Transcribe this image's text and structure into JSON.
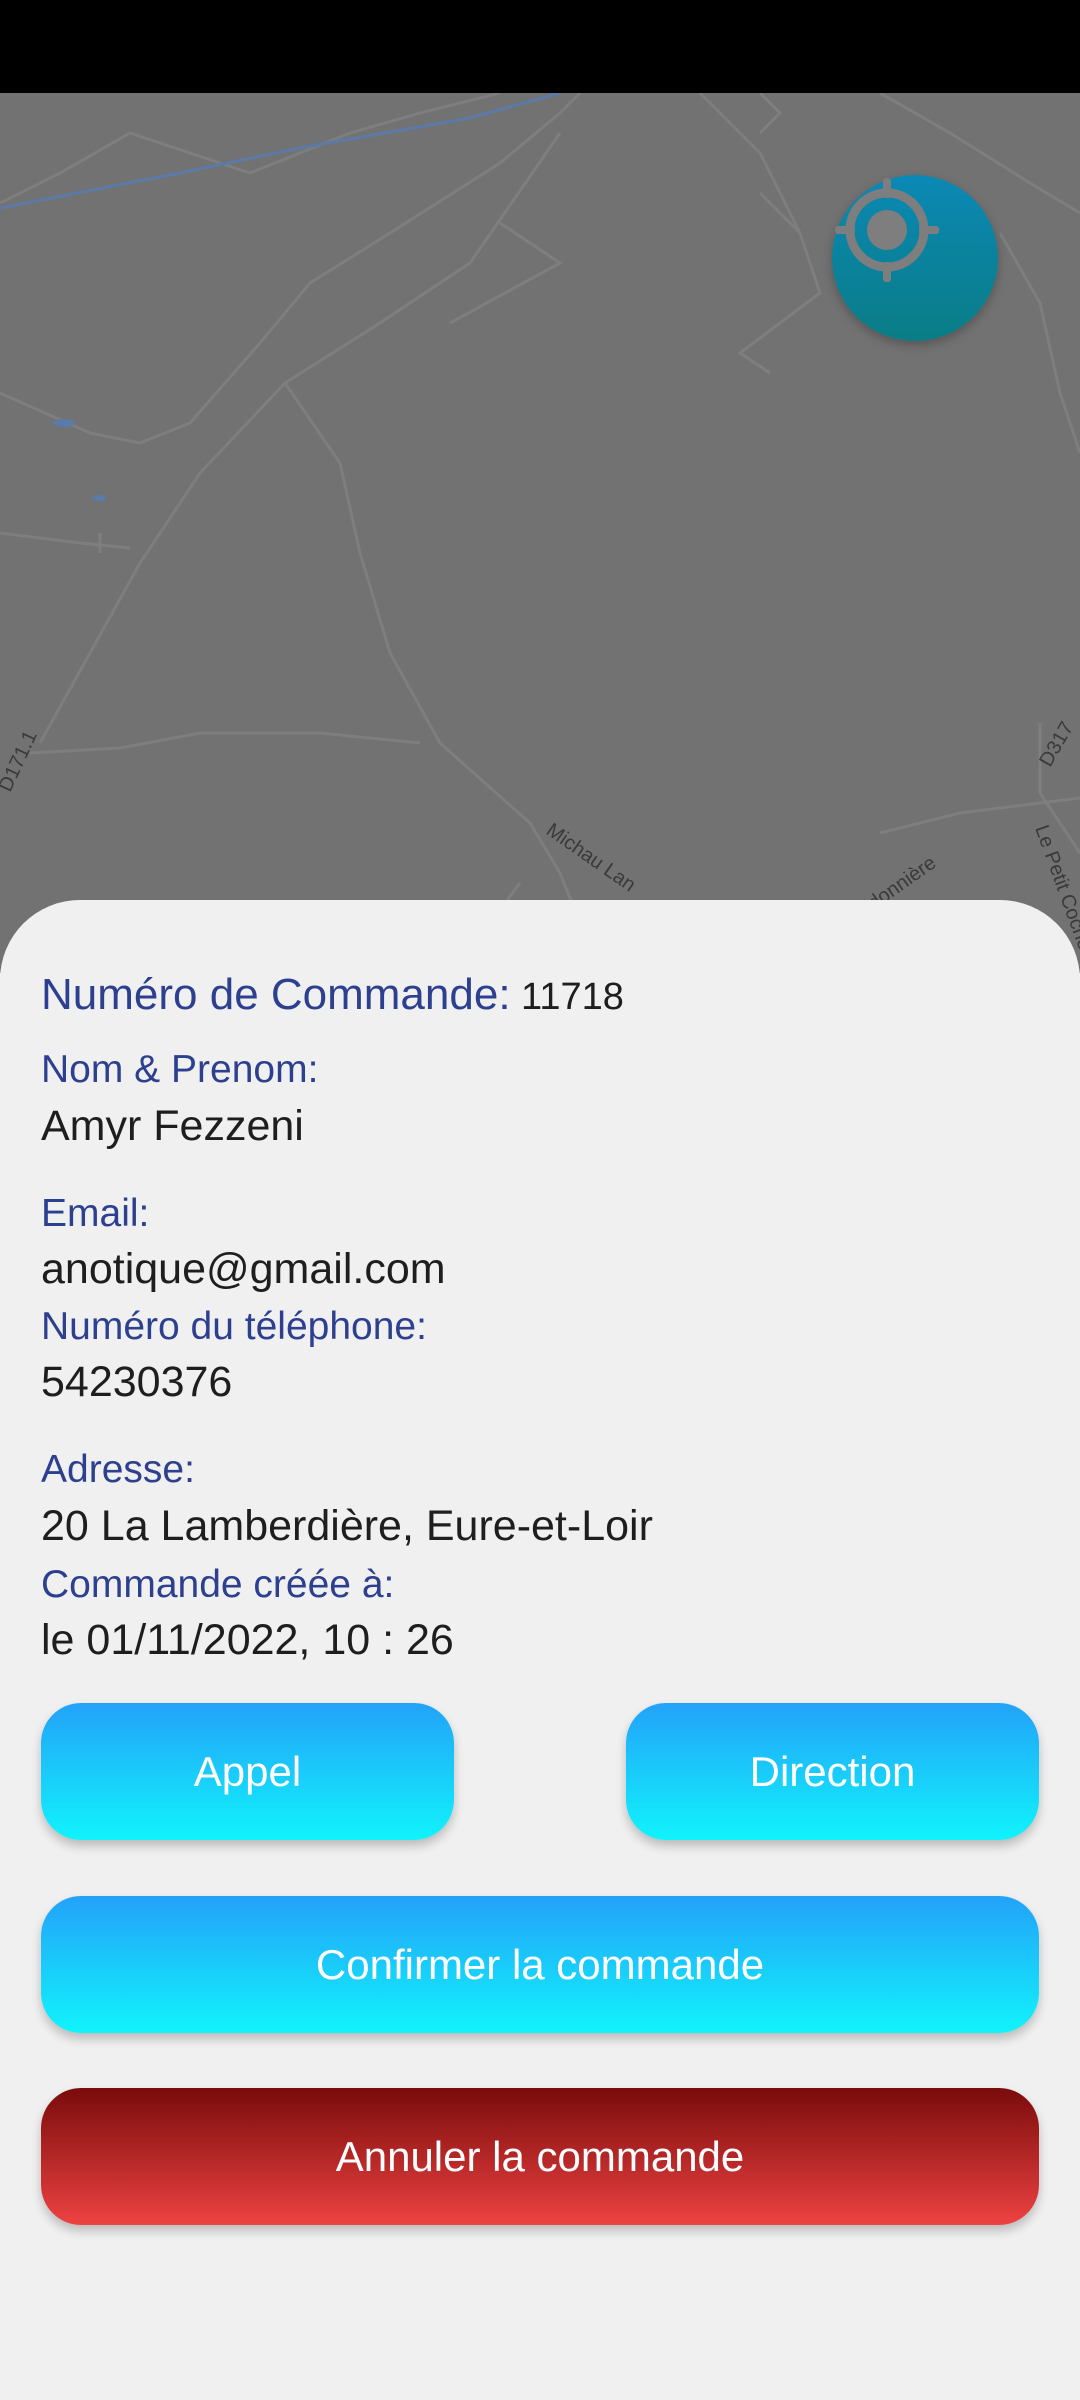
{
  "map": {
    "road_labels": [
      "D171.1",
      "Michau Lan",
      "idonnière",
      "Le Petit Cochen",
      "D317"
    ],
    "locate_button_icon": "gps-locate-icon"
  },
  "order": {
    "number_label": "Numéro de Commande:",
    "number_value": "11718",
    "name_label": "Nom & Prenom:",
    "name_value": "Amyr Fezzeni",
    "email_label": "Email:",
    "email_value": "anotique@gmail.com",
    "phone_label": "Numéro du téléphone:",
    "phone_value": "54230376",
    "address_label": "Adresse:",
    "address_value": "20 La Lamberdière, Eure-et-Loir",
    "created_label": "Commande créée à:",
    "created_value": "le 01/11/2022, 10 : 26"
  },
  "actions": {
    "call_label": "Appel",
    "direction_label": "Direction",
    "confirm_label": "Confirmer la commande",
    "cancel_label": "Annuler la commande"
  },
  "colors": {
    "label_blue": "#2d3f8f",
    "button_gradient_top": "#23a2f9",
    "button_gradient_bottom": "#11f3fc",
    "cancel_gradient_top": "#7a0b0b",
    "cancel_gradient_bottom": "#ee4242"
  }
}
